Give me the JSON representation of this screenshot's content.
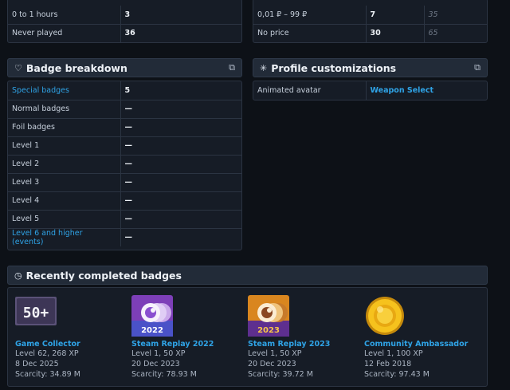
{
  "top_left": {
    "rows": [
      {
        "label": "0 to 1 hours",
        "value": "3"
      },
      {
        "label": "Never played",
        "value": "36"
      }
    ]
  },
  "top_right": {
    "rows": [
      {
        "label": "0,01 ₽ – 99 ₽",
        "value": "7",
        "extra": "35"
      },
      {
        "label": "No price",
        "value": "30",
        "extra": "65"
      }
    ]
  },
  "badge_breakdown": {
    "title": "Badge breakdown",
    "icon": "badge-outline-icon",
    "rows": [
      {
        "label": "Special badges",
        "value": "5"
      },
      {
        "label": "Normal badges",
        "value": "—"
      },
      {
        "label": "Foil badges",
        "value": "—"
      },
      {
        "label": "Level 1",
        "value": "—"
      },
      {
        "label": "Level 2",
        "value": "—"
      },
      {
        "label": "Level 3",
        "value": "—"
      },
      {
        "label": "Level 4",
        "value": "—"
      },
      {
        "label": "Level 5",
        "value": "—"
      },
      {
        "label": "Level 6 and higher (events)",
        "value": "—"
      }
    ]
  },
  "profile_customizations": {
    "title": "Profile customizations",
    "icon": "sparkle-icon",
    "rows": [
      {
        "label": "Animated avatar",
        "value": "Weapon Select"
      }
    ]
  },
  "recent_badges": {
    "title": "Recently completed badges",
    "icon": "clock-icon",
    "items": [
      {
        "name": "Game Collector",
        "level": "Level 62, 268 XP",
        "date": "8 Dec 2025",
        "scarcity": "Scarcity: 34.89 M",
        "image_text": "50+",
        "color": "#6b5e8a"
      },
      {
        "name": "Steam Replay 2022",
        "level": "Level 1, 50 XP",
        "date": "20 Dec 2023",
        "scarcity": "Scarcity: 78.93 M",
        "image_text": "2022",
        "color": "#9a4fd0"
      },
      {
        "name": "Steam Replay 2023",
        "level": "Level 1, 50 XP",
        "date": "20 Dec 2023",
        "scarcity": "Scarcity: 39.72 M",
        "image_text": "2023",
        "color": "#e08a1e"
      },
      {
        "name": "Community Ambassador",
        "level": "Level 1, 100 XP",
        "date": "12 Feb 2018",
        "scarcity": "Scarcity: 97.43 M",
        "image_text": "",
        "color": "#f2b91a"
      }
    ]
  }
}
